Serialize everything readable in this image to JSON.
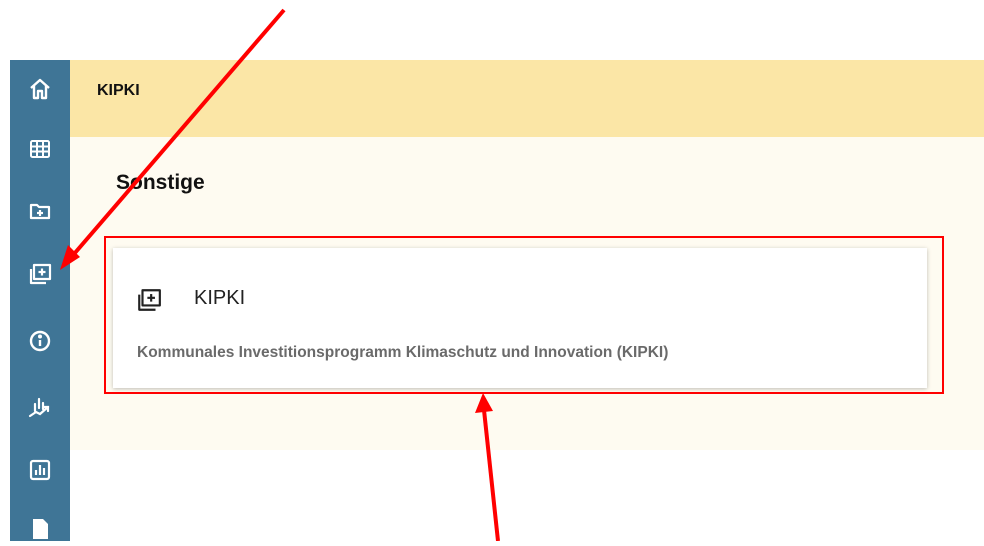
{
  "header": {
    "title": "KIPKI"
  },
  "section": {
    "title": "Sonstige"
  },
  "card": {
    "title": "KIPKI",
    "description": "Kommunales Investitionsprogramm Klimaschutz und Innovation (KIPKI)"
  },
  "sidebar": {
    "items": [
      {
        "icon": "home-icon"
      },
      {
        "icon": "grid-icon"
      },
      {
        "icon": "folder-plus-icon"
      },
      {
        "icon": "folders-plus-icon"
      },
      {
        "icon": "info-icon"
      },
      {
        "icon": "chart-trend-icon"
      },
      {
        "icon": "bar-chart-icon"
      },
      {
        "icon": "document-icon"
      }
    ]
  },
  "colors": {
    "sidebar": "#3f7596",
    "header": "#fbe6a6",
    "content": "#fefbf1",
    "annotation": "#ff0000"
  }
}
